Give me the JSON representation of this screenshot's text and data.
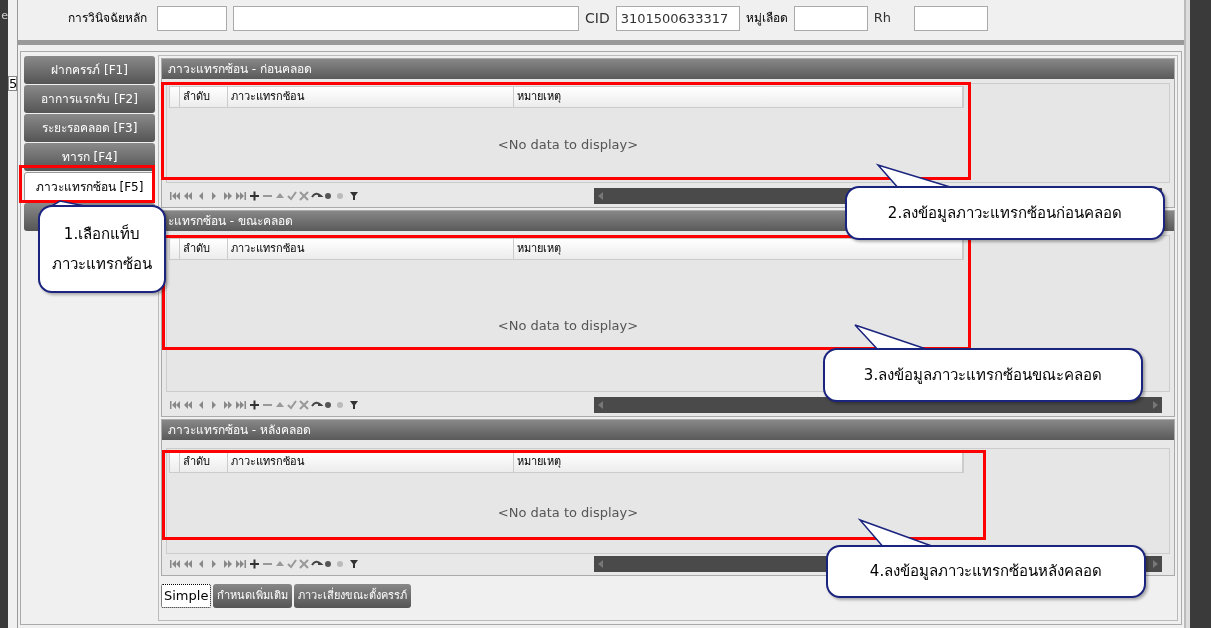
{
  "background_fragments": [
    "e",
    "5"
  ],
  "header": {
    "diagnosis_label": "การวินิจฉัยหลัก",
    "cid_label": "CID",
    "cid_value": "3101500633317",
    "blood_group_label": "หมู่เลือด",
    "rh_label": "Rh"
  },
  "side_tabs": [
    {
      "label": "ฝากครรภ์ [F1]",
      "selected": false
    },
    {
      "label": "อาการแรกรับ [F2]",
      "selected": false
    },
    {
      "label": "ระยะรอคลอด [F3]",
      "selected": false
    },
    {
      "label": "ทารก [F4]",
      "selected": false
    },
    {
      "label": "ภาวะแทรกซ้อน [F5]",
      "selected": true
    },
    {
      "selected": false
    }
  ],
  "sections": [
    {
      "title": "ภาวะแทรกซ้อน - ก่อนคลอด",
      "columns": [
        "ลำดับ",
        "ภาวะแทรกซ้อน",
        "หมายเหตุ"
      ],
      "empty_text": "<No data to display>"
    },
    {
      "title": "ะแทรกซ้อน - ขณะคลอด",
      "columns": [
        "ลำดับ",
        "ภาวะแทรกซ้อน",
        "หมายเหตุ"
      ],
      "empty_text": "<No data to display>"
    },
    {
      "title": "ภาวะแทรกซ้อน - หลังคลอด",
      "columns": [
        "ลำดับ",
        "ภาวะแทรกซ้อน",
        "หมายเหตุ"
      ],
      "empty_text": "<No data to display>"
    }
  ],
  "bottom_tabs": [
    {
      "label": "Simple",
      "selected": true
    },
    {
      "label": "กำหนดเพิ่มเติม",
      "selected": false
    },
    {
      "label": "ภาวะเสี่ยงขณะตั้งครรภ์",
      "selected": false
    }
  ],
  "callouts": [
    {
      "lines": [
        "1.เลือกแท็บ",
        "ภาวะแทรกซ้อน"
      ]
    },
    {
      "lines": [
        "2.ลงข้อมูลภาวะแทรกซ้อนก่อนคลอด"
      ]
    },
    {
      "lines": [
        "3.ลงข้อมูลภาวะแทรกซ้อนขณะคลอด"
      ]
    },
    {
      "lines": [
        "4.ลงข้อมูลภาวะแทรกซ้อนหลังคลอด"
      ]
    }
  ]
}
